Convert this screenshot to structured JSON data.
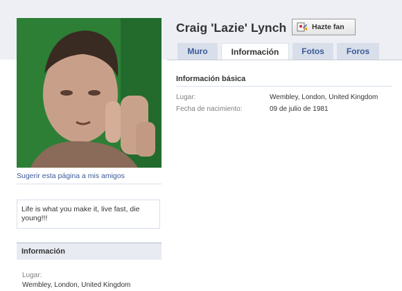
{
  "profile": {
    "name": "Craig 'Lazie' Lynch",
    "fan_button": "Hazte fan",
    "suggest_link": "Sugerir esta página a mis amigos",
    "quote": "Life is what you make it, live fast, die young!!!"
  },
  "tabs": [
    {
      "label": "Muro",
      "active": false
    },
    {
      "label": "Información",
      "active": true
    },
    {
      "label": "Fotos",
      "active": false
    },
    {
      "label": "Foros",
      "active": false
    }
  ],
  "basic_info": {
    "title": "Información básica",
    "rows": [
      {
        "label": "Lugar:",
        "value": "Wembley, London, United Kingdom"
      },
      {
        "label": "Fecha de nacimiento:",
        "value": "09 de julio de 1981"
      }
    ]
  },
  "sidebar_info": {
    "title": "Información",
    "label": "Lugar:",
    "value": "Wembley, London, United Kingdom"
  },
  "colors": {
    "link": "#3b5998",
    "tab_bg": "#d8dfea",
    "page_band": "#edeff4"
  }
}
